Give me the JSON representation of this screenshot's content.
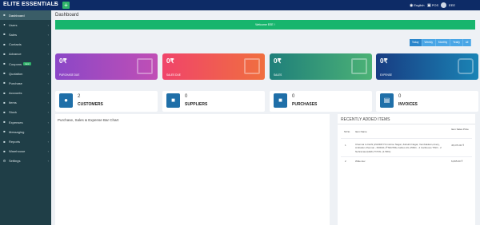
{
  "app": {
    "brand": "ELITE ESSENTIALS"
  },
  "topbar": {
    "menu_icon": "hamburger-icon",
    "add_label": "+",
    "language": "English",
    "pos": "POS",
    "user": "EEE"
  },
  "sidebar": {
    "items": [
      {
        "label": "Dashboard",
        "icon": "dashboard-icon",
        "active": true
      },
      {
        "label": "Users",
        "icon": "users-icon"
      },
      {
        "label": "Sales",
        "icon": "cart-icon"
      },
      {
        "label": "Contacts",
        "icon": "address-book-icon"
      },
      {
        "label": "Advance",
        "icon": "wallet-icon"
      },
      {
        "label": "Coupons",
        "icon": "ticket-icon",
        "badge": "new"
      },
      {
        "label": "Quotation",
        "icon": "file-icon"
      },
      {
        "label": "Purchase",
        "icon": "bag-icon"
      },
      {
        "label": "Accounts",
        "icon": "bank-icon"
      },
      {
        "label": "Items",
        "icon": "box-icon"
      },
      {
        "label": "Stock",
        "icon": "stack-icon"
      },
      {
        "label": "Expenses",
        "icon": "money-icon"
      },
      {
        "label": "Messaging",
        "icon": "message-icon"
      },
      {
        "label": "Reports",
        "icon": "chart-icon"
      },
      {
        "label": "Warehouse",
        "icon": "warehouse-icon"
      },
      {
        "label": "Settings",
        "icon": "gear-icon"
      }
    ]
  },
  "main": {
    "title": "Dashboard",
    "welcome": "Welcome EEE !",
    "filters": [
      "Today",
      "Weekly",
      "Monthly",
      "Yearly",
      "All"
    ],
    "cards": [
      {
        "amount": "0₹",
        "label": "PURCHASE DUE"
      },
      {
        "amount": "0₹",
        "label": "SALES DUE"
      },
      {
        "amount": "0₹",
        "label": "SALES"
      },
      {
        "amount": "0₹",
        "label": "EXPENSE"
      }
    ],
    "stats": [
      {
        "value": "2",
        "label": "CUSTOMERS"
      },
      {
        "value": "0",
        "label": "SUPPLIERS"
      },
      {
        "value": "0",
        "label": "PURCHASES"
      },
      {
        "value": "0",
        "label": "INVOICES"
      }
    ],
    "chart_title": "Purchase, Sales & Expense Bar Chart",
    "recent": {
      "title": "RECENTLY ADDED ITEMS",
      "headers": [
        "Sl.No",
        "Item Name",
        "Item Sales Price"
      ],
      "rows": [
        {
          "no": "1",
          "name": "Chennai to Delhi (ZAFIRFYS Insitmo Nagar, Zabukh Nagar, Vembakkam,Avery, Ambattur,Chennai - 600041) ₹TENTIRe Aslitus AG-15601 - 2 Cartboxes TWO - 2 Nehranaux(HEK) TOTAL (1.5RG)",
          "price": "45,079.00 ₹"
        },
        {
          "no": "2",
          "name": "Wide dev",
          "price": "6,095.00 ₹"
        }
      ]
    }
  }
}
